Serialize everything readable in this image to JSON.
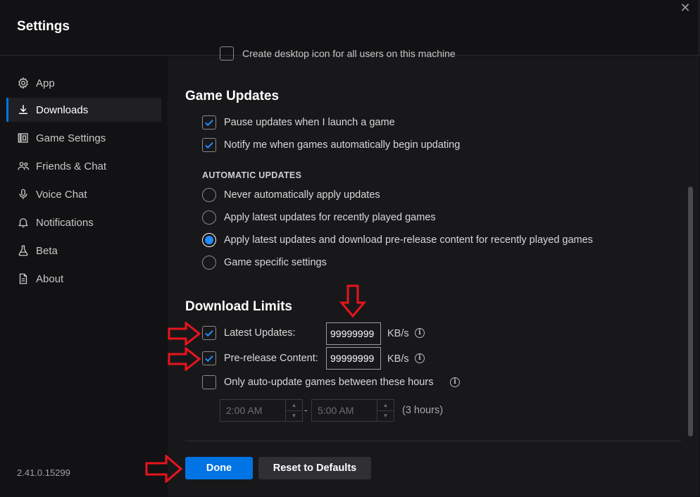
{
  "header": {
    "title": "Settings",
    "close_glyph": "✕"
  },
  "sidebar": {
    "items": [
      {
        "label": "App",
        "icon": "gear-icon"
      },
      {
        "label": "Downloads",
        "icon": "download-icon",
        "active": true
      },
      {
        "label": "Game Settings",
        "icon": "game-settings-icon"
      },
      {
        "label": "Friends & Chat",
        "icon": "friends-icon"
      },
      {
        "label": "Voice Chat",
        "icon": "microphone-icon"
      },
      {
        "label": "Notifications",
        "icon": "bell-icon"
      },
      {
        "label": "Beta",
        "icon": "flask-icon"
      },
      {
        "label": "About",
        "icon": "document-icon"
      }
    ],
    "version": "2.41.0.15299"
  },
  "content": {
    "cut_off_text": "Create desktop icon for all users on this machine",
    "game_updates": {
      "title": "Game Updates",
      "pause_updates": {
        "label": "Pause updates when I launch a game",
        "checked": true
      },
      "notify_updates": {
        "label": "Notify me when games automatically begin updating",
        "checked": true
      },
      "automatic_updates_heading": "AUTOMATIC UPDATES",
      "options": [
        {
          "label": "Never automatically apply updates",
          "selected": false
        },
        {
          "label": "Apply latest updates for recently played games",
          "selected": false
        },
        {
          "label": "Apply latest updates and download pre-release content for recently played games",
          "selected": true
        },
        {
          "label": "Game specific settings",
          "selected": false
        }
      ]
    },
    "download_limits": {
      "title": "Download Limits",
      "latest_updates": {
        "label": "Latest Updates:",
        "checked": true,
        "value": "99999999",
        "unit": "KB/s"
      },
      "prerelease": {
        "label": "Pre-release Content:",
        "checked": true,
        "value": "99999999",
        "unit": "KB/s"
      },
      "auto_update_hours": {
        "label": "Only auto-update games between these hours",
        "checked": false
      },
      "start_time": "2:00 AM",
      "end_time": "5:00 AM",
      "separator": "-",
      "duration": "(3 hours)"
    },
    "buttons": {
      "done": "Done",
      "reset": "Reset to Defaults"
    }
  },
  "colors": {
    "accent": "#0074e4",
    "radio_selected": "#1f8cff",
    "annotation_arrow": "#e8141c"
  }
}
